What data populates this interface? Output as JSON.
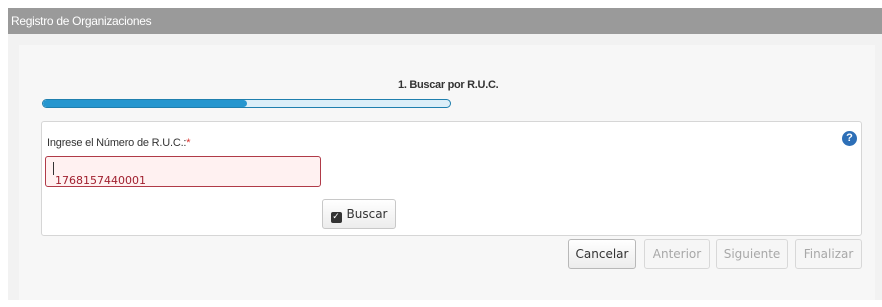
{
  "window": {
    "title": "Registro de Organizaciones"
  },
  "wizard": {
    "step_label": "1. Buscar por R.U.C.",
    "progress": 0.5
  },
  "form": {
    "ruc_label": "Ingrese el Número de R.U.C.:",
    "required_mark": "*",
    "help_icon": "question-circle-icon",
    "ruc_value": "1768157440001",
    "search_button": "Buscar",
    "search_icon": "check-square-icon"
  },
  "footer": {
    "cancel": "Cancelar",
    "previous": "Anterior",
    "next": "Siguiente",
    "finish": "Finalizar"
  },
  "colors": {
    "titlebar": "#9a9a9a",
    "progress": "#2596cf",
    "error_border": "#b03a48",
    "error_text": "#a01f2e",
    "help": "#2d6fb7"
  }
}
